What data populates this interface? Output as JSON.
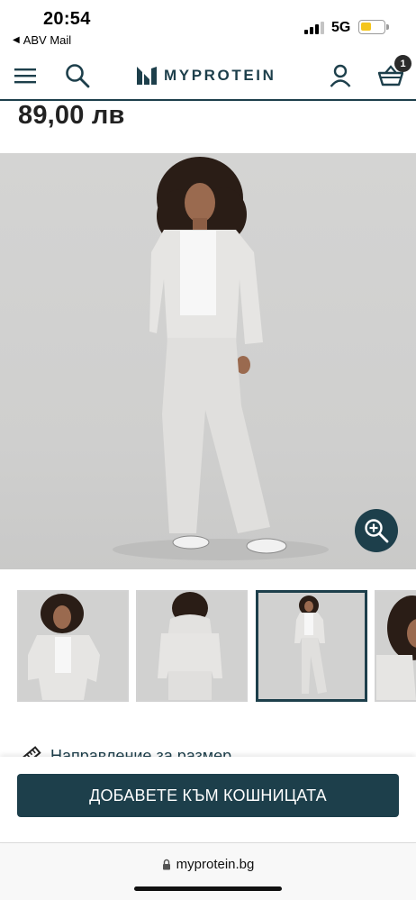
{
  "status_bar": {
    "time": "20:54",
    "back_app": "ABV Mail",
    "network": "5G",
    "battery_level": 0.35,
    "battery_color": "#f4c51c"
  },
  "header": {
    "brand": "MYPROTEIN",
    "basket_count": "1",
    "accent_color": "#1d3f4b",
    "icons": [
      "menu-icon",
      "search-icon",
      "logo-icon",
      "account-icon",
      "basket-icon"
    ]
  },
  "product": {
    "price": "89,00 лв"
  },
  "gallery": {
    "thumbnail_count": 4,
    "active_thumbnail": 3,
    "icons": [
      "zoom-in-icon"
    ]
  },
  "size_guide": {
    "label": "Направление за размер"
  },
  "cta": {
    "add_to_basket": "ДОБАВЕТЕ КЪМ КОШНИЦАТА"
  },
  "browser": {
    "url": "myprotein.bg"
  }
}
